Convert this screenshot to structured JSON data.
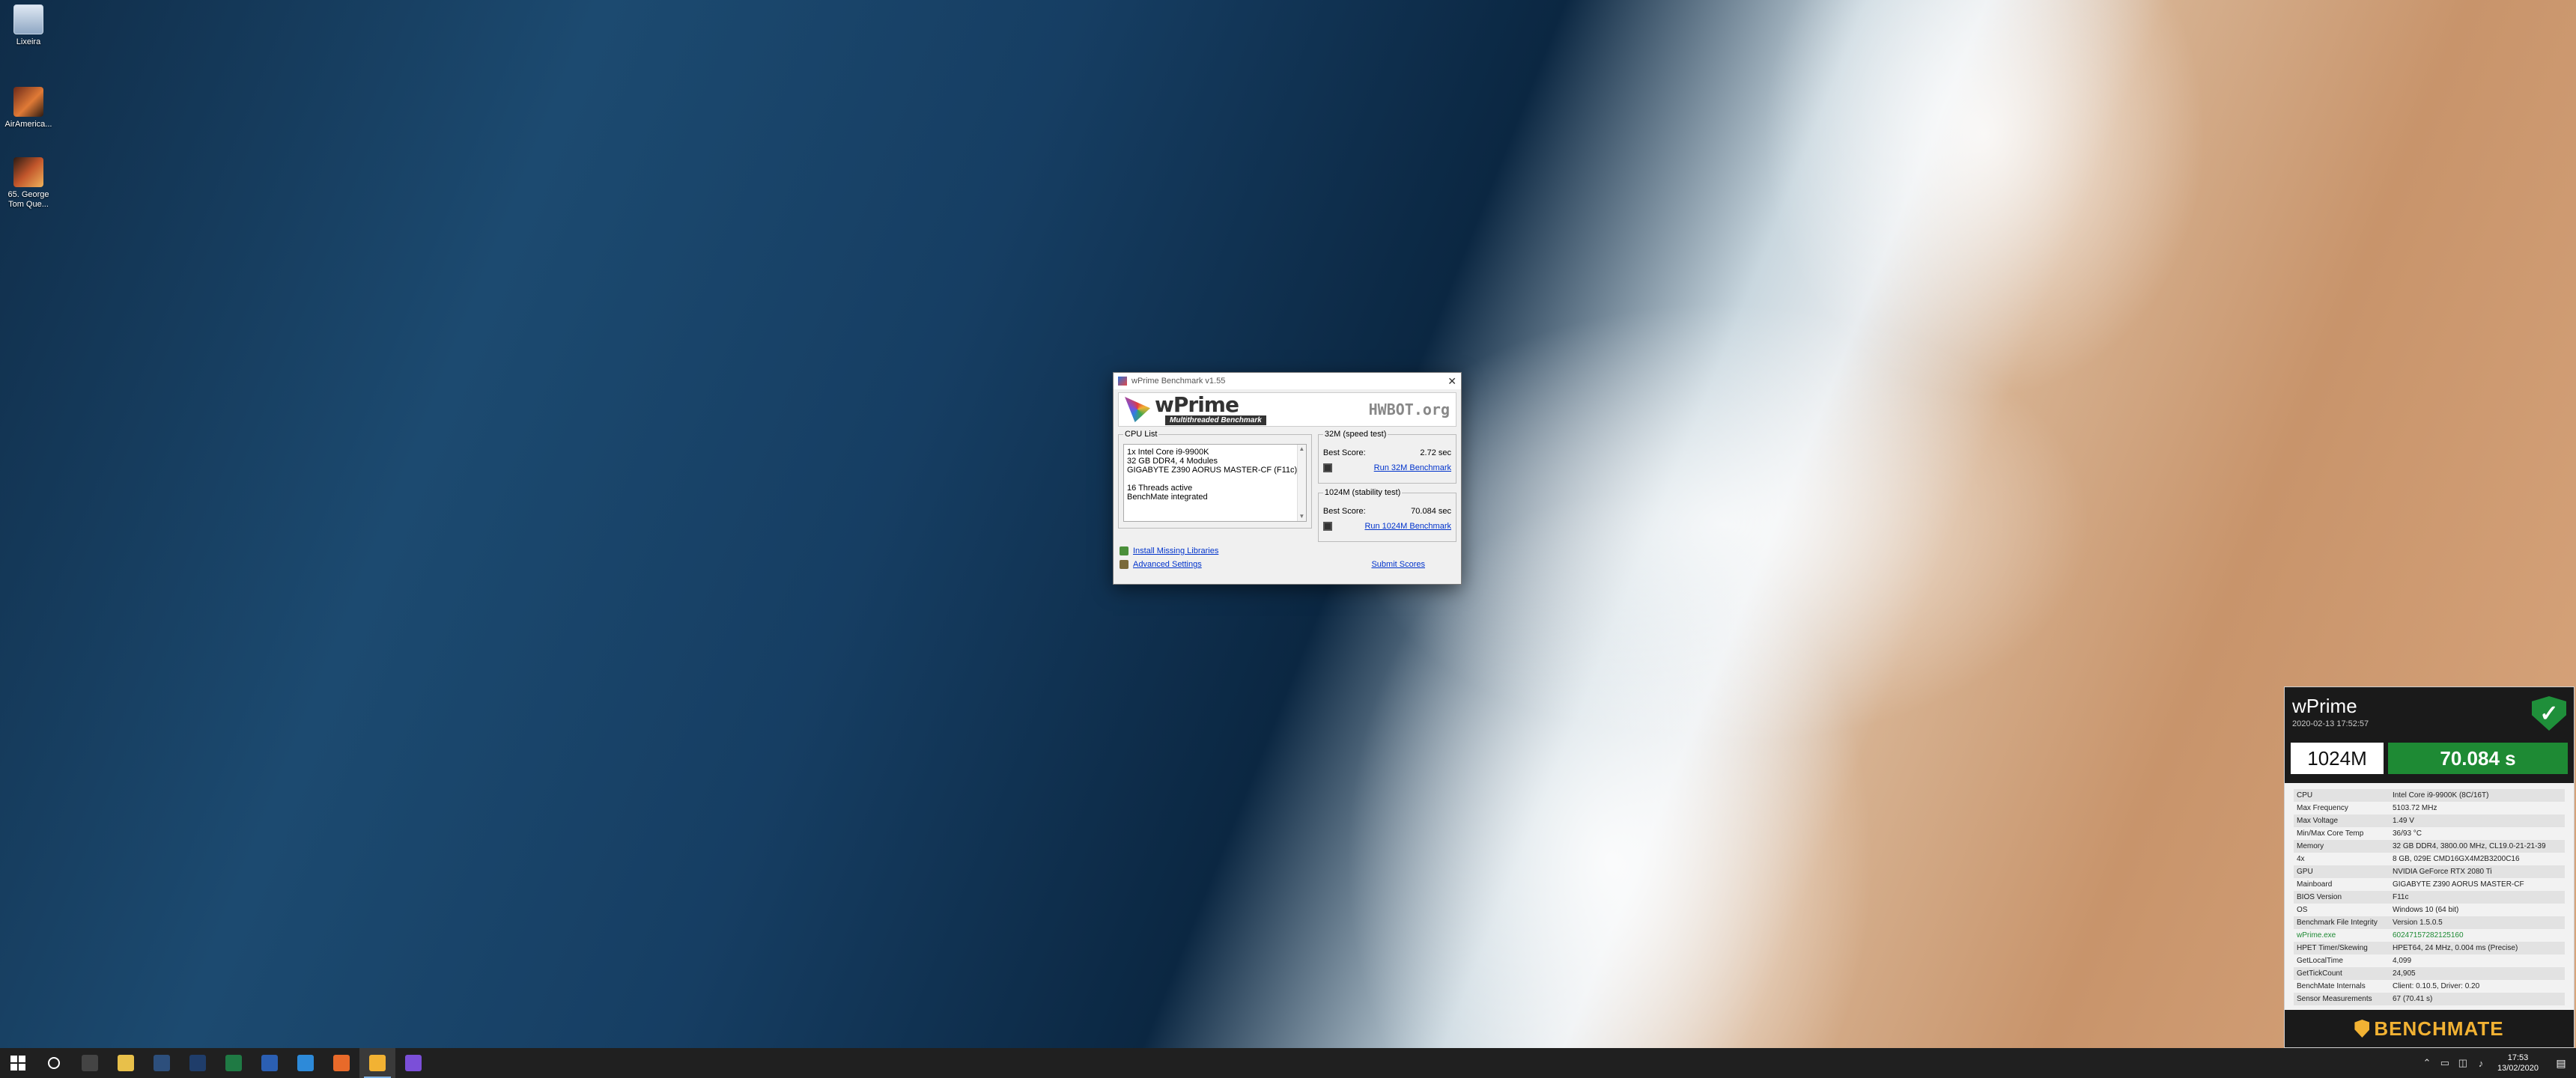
{
  "desktop_icons": [
    {
      "label": "Lixeira",
      "icon": "recycle-bin-icon"
    },
    {
      "label": "AirAmerica...",
      "icon": "game-shortcut-icon"
    },
    {
      "label": "65. George Tom Que...",
      "icon": "game-shortcut-icon"
    }
  ],
  "wprime": {
    "title": "wPrime Benchmark v1.55",
    "logo_name": "wPrime",
    "logo_tagline": "Multithreaded Benchmark",
    "hwbot_brand": "HWBOT.org",
    "cpu_list_label": "CPU List",
    "cpu_lines": [
      "1x Intel Core i9-9900K",
      "32 GB DDR4, 4 Modules",
      "GIGABYTE Z390 AORUS MASTER-CF (F11c)"
    ],
    "status_lines": [
      "16 Threads active",
      "BenchMate integrated"
    ],
    "test32": {
      "legend": "32M (speed test)",
      "best_label": "Best Score:",
      "best_value": "2.72 sec",
      "run_label": "Run 32M Benchmark"
    },
    "test1024": {
      "legend": "1024M (stability test)",
      "best_label": "Best Score:",
      "best_value": "70.084 sec",
      "run_label": "Run 1024M Benchmark"
    },
    "install_libs": "Install Missing Libraries",
    "advanced_settings": "Advanced Settings",
    "submit_scores": "Submit Scores"
  },
  "benchmate": {
    "title": "wPrime",
    "date": "2020-02-13 17:52:57",
    "size": "1024M",
    "time": "70.084 s",
    "rows": [
      {
        "k": "CPU",
        "v": "Intel Core i9-9900K (8C/16T)"
      },
      {
        "k": "Max Frequency",
        "v": "5103.72 MHz"
      },
      {
        "k": "Max Voltage",
        "v": "1.49 V"
      },
      {
        "k": "Min/Max Core Temp",
        "v": "36/93 °C"
      },
      {
        "k": "Memory",
        "v": "32 GB DDR4, 3800.00 MHz, CL19.0-21-21-39"
      },
      {
        "k": "4x",
        "v": "8 GB, 029E CMD16GX4M2B3200C16"
      },
      {
        "k": "GPU",
        "v": "NVIDIA GeForce RTX 2080 Ti"
      },
      {
        "k": "Mainboard",
        "v": "GIGABYTE Z390 AORUS MASTER-CF"
      },
      {
        "k": "BIOS Version",
        "v": "F11c"
      },
      {
        "k": "OS",
        "v": "Windows 10 (64 bit)"
      },
      {
        "k": "Benchmark File Integrity",
        "v": "Version 1.5.0.5"
      },
      {
        "k": "wPrime.exe",
        "v": "60247157282125160",
        "green": true
      },
      {
        "k": "HPET Timer/Skewing",
        "v": "HPET64, 24 MHz, 0.004 ms (Precise)"
      },
      {
        "k": "GetLocalTime",
        "v": "4,099"
      },
      {
        "k": "GetTickCount",
        "v": "24,905"
      },
      {
        "k": "BenchMate Internals",
        "v": "Client: 0.10.5, Driver: 0.20"
      },
      {
        "k": "Sensor Measurements",
        "v": "67 (70.41 s)"
      }
    ],
    "footer_brand": "BENCHMATE"
  },
  "taskbar": {
    "apps": [
      {
        "name": "taskbar-terminal",
        "color": "#444444"
      },
      {
        "name": "taskbar-file-explorer",
        "color": "#e8c04a"
      },
      {
        "name": "taskbar-lightroom",
        "color": "#2d4f7c"
      },
      {
        "name": "taskbar-photoshop",
        "color": "#1f3d6a"
      },
      {
        "name": "taskbar-excel",
        "color": "#1f7a44"
      },
      {
        "name": "taskbar-word",
        "color": "#2b5fb3"
      },
      {
        "name": "taskbar-vscode",
        "color": "#2d8ad9"
      },
      {
        "name": "taskbar-firefox",
        "color": "#e86a2a"
      },
      {
        "name": "taskbar-benchmate",
        "color": "#f2b233",
        "active": true
      },
      {
        "name": "taskbar-wprime",
        "color": "#7b4fd8"
      }
    ],
    "time": "17:53",
    "date": "13/02/2020"
  }
}
